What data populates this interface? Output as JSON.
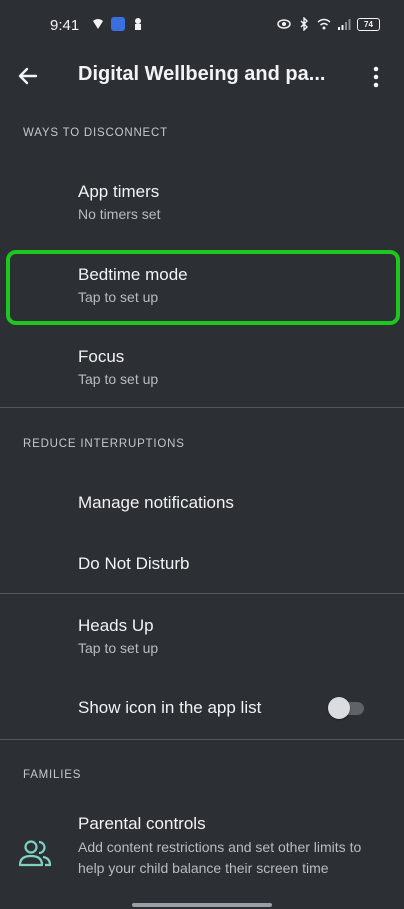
{
  "status_bar": {
    "time": "9:41",
    "battery": "74",
    "icons": [
      "notification-icon",
      "app-icon",
      "lock-icon",
      "eye-icon",
      "bluetooth-icon",
      "wifi-icon",
      "signal-icon"
    ]
  },
  "app_bar": {
    "title": "Digital Wellbeing and pa..."
  },
  "sections": {
    "ways": {
      "header": "WAYS TO DISCONNECT"
    },
    "reduce": {
      "header": "REDUCE INTERRUPTIONS"
    },
    "families": {
      "header": "FAMILIES"
    }
  },
  "items": {
    "app_timers": {
      "title": "App timers",
      "subtitle": "No timers set"
    },
    "bedtime": {
      "title": "Bedtime mode",
      "subtitle": "Tap to set up"
    },
    "focus": {
      "title": "Focus",
      "subtitle": "Tap to set up"
    },
    "manage_notifications": {
      "title": "Manage notifications"
    },
    "dnd": {
      "title": "Do Not Disturb"
    },
    "heads_up": {
      "title": "Heads Up",
      "subtitle": "Tap to set up"
    },
    "show_icon": {
      "title": "Show icon in the app list",
      "toggle_on": false
    },
    "parental": {
      "title": "Parental controls",
      "subtitle": "Add content restrictions and set other limits to help your child balance their screen time"
    }
  },
  "colors": {
    "background": "#2c2f33",
    "highlight": "#1ec71e",
    "accent_icon": "#7fd1c3"
  }
}
